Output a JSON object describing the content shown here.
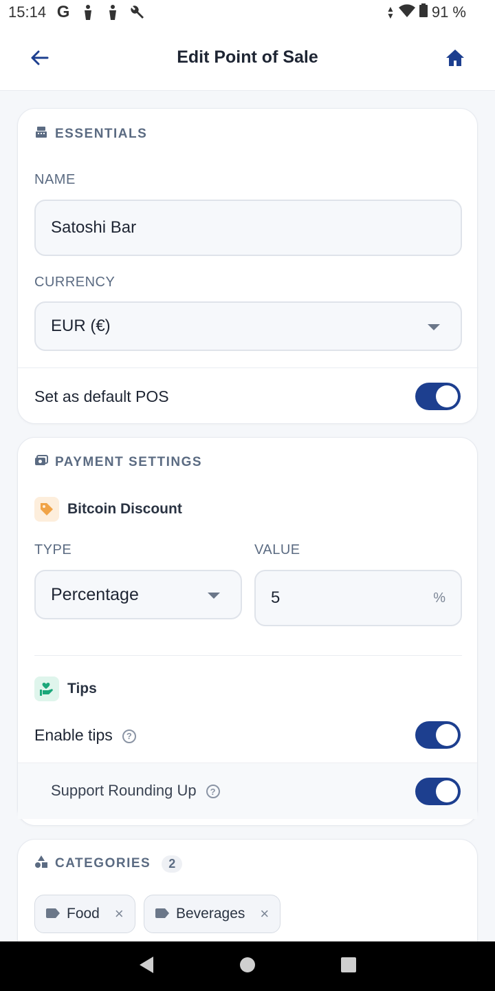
{
  "status_bar": {
    "time": "15:14",
    "battery": "91 %",
    "icons": [
      "google-icon",
      "accessibility-icon",
      "accessibility-icon",
      "wrench-icon",
      "data-arrows-icon",
      "wifi-icon",
      "battery-icon"
    ]
  },
  "app_bar": {
    "title": "Edit Point of Sale",
    "back_icon": "arrow-left-icon",
    "home_icon": "home-icon",
    "accent": "#1d3f8f"
  },
  "essentials": {
    "heading": "ESSENTIALS",
    "name_label": "NAME",
    "name_value": "Satoshi Bar",
    "currency_label": "CURRENCY",
    "currency_value": "EUR (€)",
    "default_label": "Set as default POS",
    "default_on": true
  },
  "payment": {
    "heading": "PAYMENT SETTINGS",
    "discount_title": "Bitcoin Discount",
    "type_label": "TYPE",
    "type_value": "Percentage",
    "value_label": "VALUE",
    "value_value": "5",
    "value_unit": "%",
    "tips_title": "Tips",
    "enable_tips_label": "Enable tips",
    "enable_tips_on": true,
    "rounding_label": "Support Rounding Up",
    "rounding_on": true,
    "help_glyph": "?"
  },
  "categories": {
    "heading": "CATEGORIES",
    "count": "2",
    "items": [
      {
        "label": "Food"
      },
      {
        "label": "Beverages"
      }
    ],
    "remove_glyph": "×"
  }
}
